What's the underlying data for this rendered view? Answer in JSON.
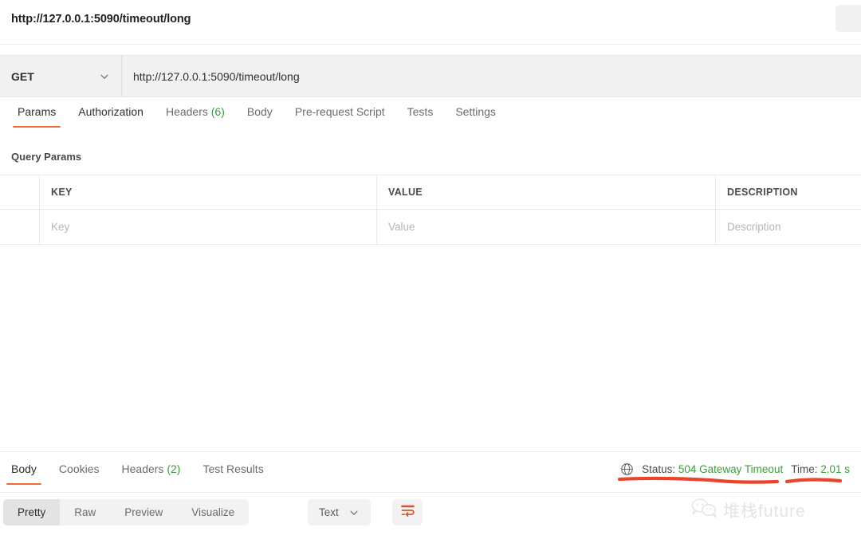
{
  "titlebar": {
    "title": "http://127.0.0.1:5090/timeout/long",
    "action_icon": "save-button-icon"
  },
  "request": {
    "method": "GET",
    "method_chevron_icon": "chevron-down-icon",
    "url": "http://127.0.0.1:5090/timeout/long",
    "tabs": [
      {
        "label": "Params",
        "count": "",
        "active": true
      },
      {
        "label": "Authorization",
        "count": "",
        "active": false
      },
      {
        "label": "Headers",
        "count": "(6)",
        "active": false
      },
      {
        "label": "Body",
        "count": "",
        "active": false
      },
      {
        "label": "Pre-request Script",
        "count": "",
        "active": false
      },
      {
        "label": "Tests",
        "count": "",
        "active": false
      },
      {
        "label": "Settings",
        "count": "",
        "active": false
      }
    ]
  },
  "query_params": {
    "section_title": "Query Params",
    "columns": [
      "",
      "KEY",
      "VALUE",
      "DESCRIPTION"
    ],
    "rows": [
      {
        "key": "Key",
        "value": "Value",
        "description": "Description"
      }
    ]
  },
  "response": {
    "tabs": [
      {
        "label": "Body",
        "count": "",
        "active": true
      },
      {
        "label": "Cookies",
        "count": "",
        "active": false
      },
      {
        "label": "Headers",
        "count": "(2)",
        "active": false
      },
      {
        "label": "Test Results",
        "count": "",
        "active": false
      }
    ],
    "globe_icon": "globe-icon",
    "status_label": "Status:",
    "status_value": "504 Gateway Timeout",
    "time_label": "Time:",
    "time_value": "2.01 s"
  },
  "viewer_toolbar": {
    "segments": [
      {
        "label": "Pretty",
        "selected": true
      },
      {
        "label": "Raw",
        "selected": false
      },
      {
        "label": "Preview",
        "selected": false
      },
      {
        "label": "Visualize",
        "selected": false
      }
    ],
    "format_value": "Text",
    "format_chevron_icon": "chevron-down-icon",
    "wrap_icon": "word-wrap-icon"
  },
  "watermark": {
    "icon": "wechat-icon",
    "text": "堆栈future"
  },
  "colors": {
    "accent": "#ef6c33",
    "success": "#3d9a3d",
    "annotation": "#e8452c",
    "panel": "#f1f1f2"
  }
}
